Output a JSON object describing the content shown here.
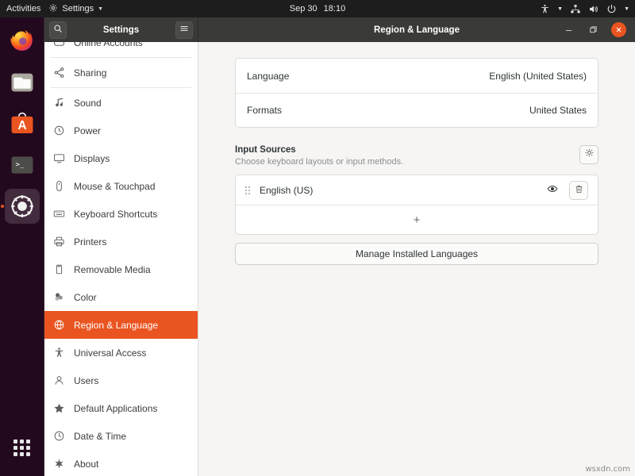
{
  "topbar": {
    "activities": "Activities",
    "app_name": "Settings",
    "app_icon": "gear-icon",
    "clock_date": "Sep 30",
    "clock_time": "18:10",
    "tray_icons": [
      "accessibility-icon",
      "chevron-down-icon",
      "network-icon",
      "volume-icon",
      "power-icon",
      "chevron-down-icon"
    ]
  },
  "dock": {
    "items": [
      {
        "name": "firefox",
        "label": "Firefox"
      },
      {
        "name": "files",
        "label": "Files"
      },
      {
        "name": "ubuntu-software",
        "label": "Ubuntu Software"
      },
      {
        "name": "terminal",
        "label": "Terminal"
      },
      {
        "name": "settings",
        "label": "Settings",
        "active": true
      }
    ],
    "show_applications": "Show Applications"
  },
  "window": {
    "sidebar_title": "Settings",
    "title": "Region & Language",
    "search_icon": "search-icon",
    "menu_icon": "hamburger-menu-icon",
    "controls": {
      "minimize": "–",
      "maximize": "❐",
      "close": "✕"
    }
  },
  "sidebar": {
    "items": [
      {
        "label": "Online Accounts",
        "icon": "cloud-icon",
        "name": "sidebar-item-online-accounts"
      },
      {
        "label": "Sharing",
        "icon": "share-icon",
        "name": "sidebar-item-sharing"
      },
      {
        "label": "Sound",
        "icon": "music-note-icon",
        "name": "sidebar-item-sound"
      },
      {
        "label": "Power",
        "icon": "power-clock-icon",
        "name": "sidebar-item-power"
      },
      {
        "label": "Displays",
        "icon": "display-icon",
        "name": "sidebar-item-displays"
      },
      {
        "label": "Mouse & Touchpad",
        "icon": "mouse-icon",
        "name": "sidebar-item-mouse-touchpad"
      },
      {
        "label": "Keyboard Shortcuts",
        "icon": "keyboard-icon",
        "name": "sidebar-item-keyboard-shortcuts"
      },
      {
        "label": "Printers",
        "icon": "printer-icon",
        "name": "sidebar-item-printers"
      },
      {
        "label": "Removable Media",
        "icon": "removable-media-icon",
        "name": "sidebar-item-removable-media"
      },
      {
        "label": "Color",
        "icon": "color-icon",
        "name": "sidebar-item-color"
      },
      {
        "label": "Region & Language",
        "icon": "globe-icon",
        "name": "sidebar-item-region-language",
        "selected": true
      },
      {
        "label": "Universal Access",
        "icon": "accessibility-icon",
        "name": "sidebar-item-universal-access"
      },
      {
        "label": "Users",
        "icon": "user-icon",
        "name": "sidebar-item-users"
      },
      {
        "label": "Default Applications",
        "icon": "star-icon",
        "name": "sidebar-item-default-applications"
      },
      {
        "label": "Date & Time",
        "icon": "clock-icon",
        "name": "sidebar-item-date-time"
      },
      {
        "label": "About",
        "icon": "info-icon",
        "name": "sidebar-item-about"
      }
    ]
  },
  "content": {
    "language_row": {
      "label": "Language",
      "value": "English (United States)"
    },
    "formats_row": {
      "label": "Formats",
      "value": "United States"
    },
    "input_sources": {
      "title": "Input Sources",
      "subtitle": "Choose keyboard layouts or input methods.",
      "options_icon": "gear-icon",
      "entries": [
        {
          "label": "English (US)",
          "drag_icon": "drag-handle-icon",
          "preview_icon": "eye-icon",
          "remove_icon": "trash-icon"
        }
      ],
      "add_label": "+"
    },
    "manage_button": "Manage Installed Languages"
  },
  "watermark": "wsxdn.com",
  "colors": {
    "accent": "#e95420",
    "topbar_bg": "#1d1d1d",
    "headerbar_bg": "#3a3a38",
    "content_bg": "#f6f5f4"
  }
}
